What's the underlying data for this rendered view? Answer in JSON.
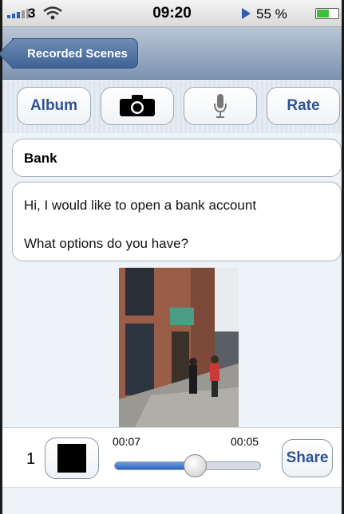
{
  "status_bar": {
    "carrier": "3",
    "time": "09:20",
    "battery_text": "55 %",
    "battery_level": 0.55
  },
  "nav": {
    "back_label": "Recorded Scenes"
  },
  "toolbar": {
    "album_label": "Album",
    "camera_icon": "camera-icon",
    "mic_icon": "microphone-icon",
    "rate_label": "Rate"
  },
  "scene": {
    "title": "Bank",
    "lines": [
      "Hi, I would like to open a bank account",
      "What options do you have?"
    ]
  },
  "player": {
    "index": "1",
    "elapsed": "00:07",
    "remaining": "00:05",
    "progress": 0.55,
    "share_label": "Share"
  },
  "colors": {
    "accent": "#2e5394",
    "nav_bar": "#7b93b1",
    "slider_fill": "#2a62c4"
  }
}
